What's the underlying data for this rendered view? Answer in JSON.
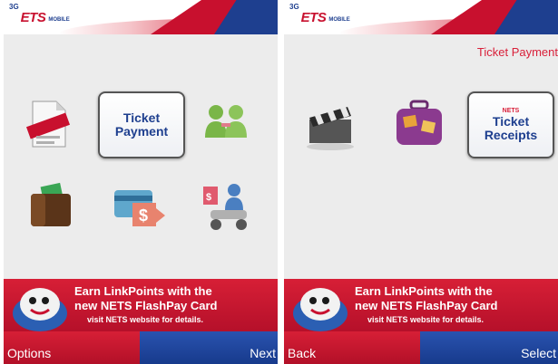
{
  "left_screen": {
    "logo": {
      "badge": "3G",
      "brand": "ETS",
      "suffix": "MOBILE"
    },
    "menu": {
      "selected_tile": {
        "line1": "Ticket",
        "line2": "Payment"
      },
      "icons": [
        "document-icon",
        "ticket-payment-tile",
        "people-icon",
        "wallet-icon",
        "card-topup-icon",
        "scooter-person-icon"
      ]
    },
    "banner": {
      "line1": "Earn LinkPoints with the",
      "line2": "new NETS FlashPay Card",
      "line3": "visit NETS website for details."
    },
    "softkeys": {
      "left": "Options",
      "right": "Next"
    }
  },
  "right_screen": {
    "logo": {
      "badge": "3G",
      "brand": "ETS",
      "suffix": "MOBILE"
    },
    "title": "Ticket Payment",
    "menu": {
      "selected_tile": {
        "line0": "NETS",
        "line1": "Ticket",
        "line2": "Receipts"
      },
      "icons": [
        "clapperboard-icon",
        "suitcase-icon",
        "ticket-receipts-tile"
      ]
    },
    "banner": {
      "line1": "Earn LinkPoints with the",
      "line2": "new NETS FlashPay Card",
      "line3": "visit NETS website for details."
    },
    "softkeys": {
      "left": "Back",
      "right": "Select"
    }
  },
  "colors": {
    "brand_red": "#c8102e",
    "brand_blue": "#1e3f8f",
    "background": "#ececec"
  }
}
